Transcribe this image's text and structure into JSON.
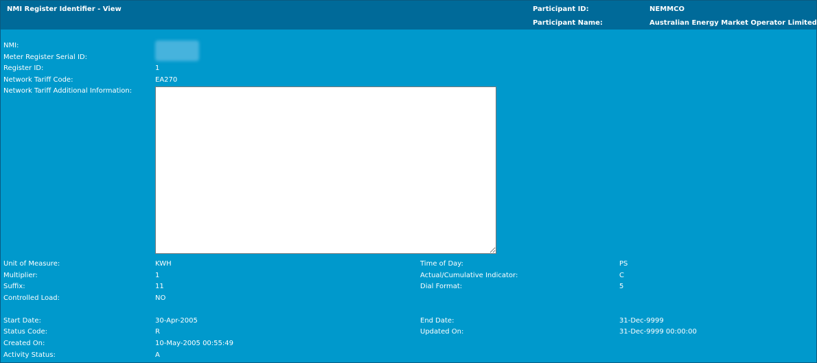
{
  "header": {
    "title": "NMI Register Identifier - View",
    "participant_id_label": "Participant ID:",
    "participant_id_value": "NEMMCO",
    "participant_name_label": "Participant Name:",
    "participant_name_value": "Australian Energy Market Operator Limited"
  },
  "fields": {
    "nmi_label": "NMI:",
    "meter_serial_label": "Meter Register Serial ID:",
    "register_id_label": "Register ID:",
    "register_id_value": "1",
    "tariff_code_label": "Network Tariff Code:",
    "tariff_code_value": "EA270",
    "tariff_info_label": "Network Tariff Additional Information:",
    "tariff_info_value": "",
    "unit_label": "Unit of Measure:",
    "unit_value": "KWH",
    "multiplier_label": "Multiplier:",
    "multiplier_value": "1",
    "suffix_label": "Suffix:",
    "suffix_value": "11",
    "controlled_load_label": "Controlled Load:",
    "controlled_load_value": "NO",
    "time_of_day_label": "Time of Day:",
    "time_of_day_value": "PS",
    "actual_cumulative_label": "Actual/Cumulative Indicator:",
    "actual_cumulative_value": "C",
    "dial_format_label": "Dial Format:",
    "dial_format_value": "5",
    "start_date_label": "Start Date:",
    "start_date_value": "30-Apr-2005",
    "status_code_label": "Status Code:",
    "status_code_value": "R",
    "created_on_label": "Created On:",
    "created_on_value": "10-May-2005 00:55:49",
    "activity_status_label": "Activity Status:",
    "activity_status_value": "A",
    "end_date_label": "End Date:",
    "end_date_value": "31-Dec-9999",
    "updated_on_label": "Updated On:",
    "updated_on_value": "31-Dec-9999 00:00:00"
  },
  "colors": {
    "background": "#0099cc",
    "header": "#006a99",
    "text": "#ffffff"
  }
}
